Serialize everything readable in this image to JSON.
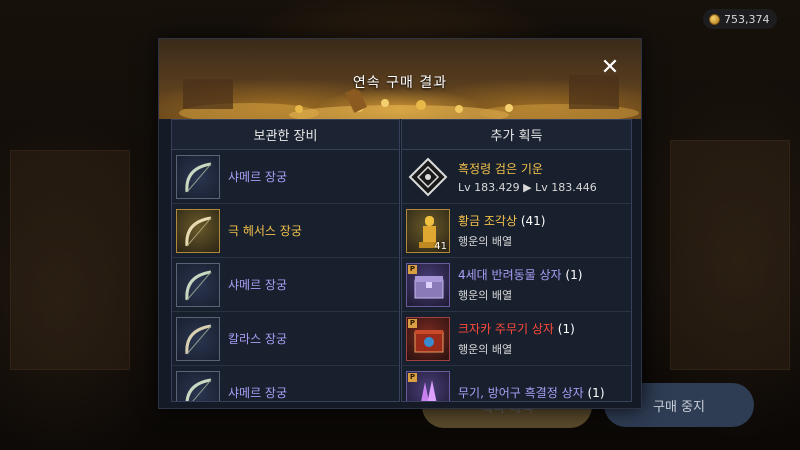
{
  "currency": {
    "icon": "coin-icon",
    "amount": "753,374"
  },
  "background_buttons": {
    "effect_label": "획득 혜택",
    "stop_label": "구매 중지"
  },
  "modal": {
    "title": "연속 구매 결과",
    "close_icon": "close-icon",
    "left_panel": {
      "header": "보관한 장비",
      "items": [
        {
          "name": "샤메르 장궁",
          "color": "#a99ef5",
          "icon": "bow-icon"
        },
        {
          "name": "극 헤서스 장궁",
          "color": "#f2c04a",
          "icon": "bow-icon"
        },
        {
          "name": "샤메르 장궁",
          "color": "#a99ef5",
          "icon": "bow-icon"
        },
        {
          "name": "칼라스 장궁",
          "color": "#a99ef5",
          "icon": "bow-icon"
        },
        {
          "name": "샤메르 장궁",
          "color": "#a99ef5",
          "icon": "bow-icon"
        }
      ]
    },
    "right_panel": {
      "header": "추가 획득",
      "items": [
        {
          "name": "흑정령 검은 기운",
          "count": "",
          "sub": "Lv 183.429 ▶ Lv 183.446",
          "color": "#f2c04a",
          "icon": "black-spirit-icon"
        },
        {
          "name": "황금 조각상",
          "count": "(41)",
          "sub": "행운의 배열",
          "color": "#f2c04a",
          "icon": "golden-statue-icon",
          "qty": "41"
        },
        {
          "name": "4세대 반려동물 상자",
          "count": "(1)",
          "sub": "행운의 배열",
          "color": "#a99ef5",
          "icon": "pet-box-icon"
        },
        {
          "name": "크자카 주무기 상자",
          "count": "(1)",
          "sub": "행운의 배열",
          "color": "#ff4a3a",
          "icon": "weapon-box-icon"
        },
        {
          "name": "무기, 방어구 흑결정 상자",
          "count": "(1)",
          "sub": "",
          "color": "#a99ef5",
          "icon": "crystal-box-icon"
        }
      ]
    }
  }
}
